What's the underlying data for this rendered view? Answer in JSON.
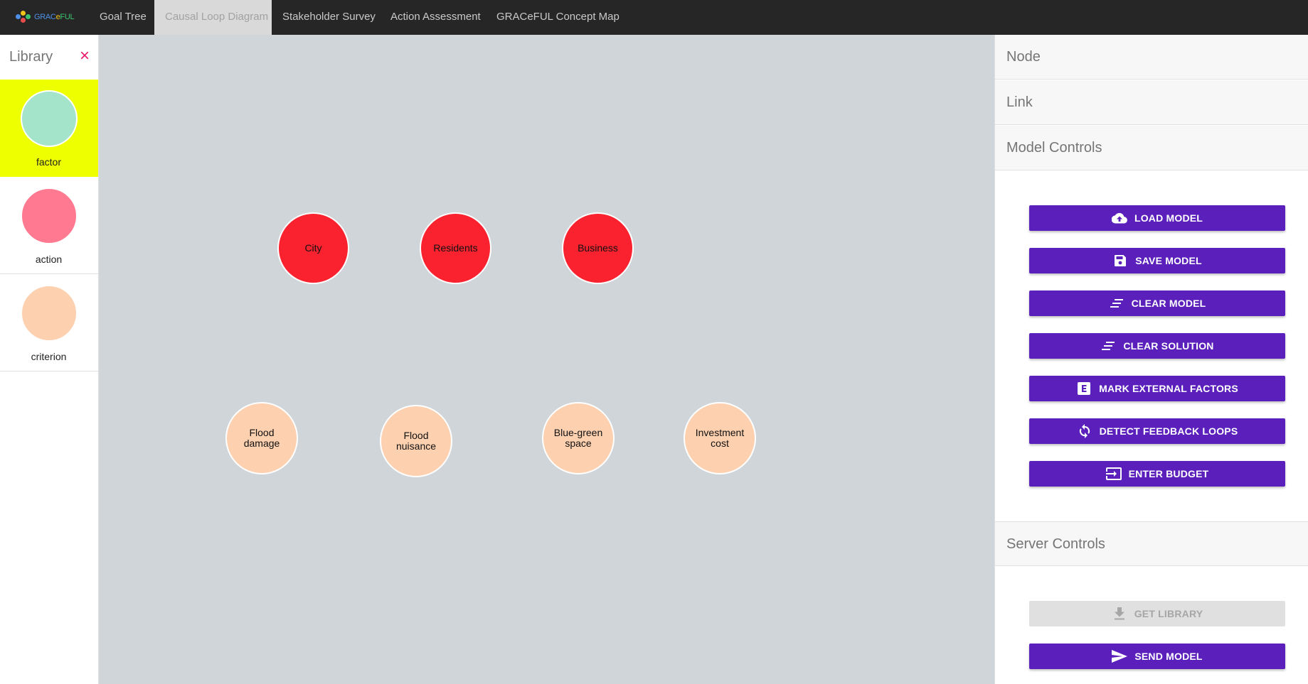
{
  "app": {
    "logo_text": {
      "a": "GRAC",
      "b": "e",
      "c": "FUL"
    },
    "tabs": [
      {
        "label": "Goal Tree"
      },
      {
        "label": "Causal Loop Diagram",
        "active": true
      },
      {
        "label": "Stakeholder Survey"
      },
      {
        "label": "Action Assessment"
      },
      {
        "label": "GRACeFUL Concept Map"
      }
    ]
  },
  "library": {
    "title": "Library",
    "close_icon": "×",
    "items": [
      {
        "label": "factor",
        "color": "#a3e4cb",
        "selected": true
      },
      {
        "label": "action",
        "color": "#ff7a90"
      },
      {
        "label": "criterion",
        "color": "#fdd0b0"
      }
    ]
  },
  "diagram": {
    "nodes": [
      {
        "label": "City",
        "type": "factor"
      },
      {
        "label": "Residents",
        "type": "factor"
      },
      {
        "label": "Business",
        "type": "factor"
      },
      {
        "label": "Flood damage",
        "type": "criterion"
      },
      {
        "label": "Flood nuisance",
        "type": "criterion"
      },
      {
        "label": "Blue-green space",
        "type": "criterion"
      },
      {
        "label": "Investment cost",
        "type": "criterion"
      }
    ]
  },
  "panel": {
    "sections": {
      "node": "Node",
      "link": "Link",
      "model_controls": "Model Controls",
      "server_controls": "Server Controls"
    },
    "model_buttons": [
      {
        "label": "LOAD MODEL",
        "icon": "cloud-upload-icon"
      },
      {
        "label": "SAVE MODEL",
        "icon": "save-icon"
      },
      {
        "label": "CLEAR MODEL",
        "icon": "clear-lines-icon"
      },
      {
        "label": "CLEAR SOLUTION",
        "icon": "clear-lines-icon"
      },
      {
        "label": "MARK EXTERNAL FACTORS",
        "icon": "external-e-icon"
      },
      {
        "label": "DETECT FEEDBACK LOOPS",
        "icon": "loop-icon"
      },
      {
        "label": "ENTER BUDGET",
        "icon": "input-arrow-icon"
      }
    ],
    "server_buttons": [
      {
        "label": "GET LIBRARY",
        "icon": "download-icon",
        "disabled": true
      },
      {
        "label": "SEND MODEL",
        "icon": "send-icon"
      }
    ],
    "colors": {
      "button": "#5b1fbb",
      "disabled": "#e0e0e0"
    }
  }
}
